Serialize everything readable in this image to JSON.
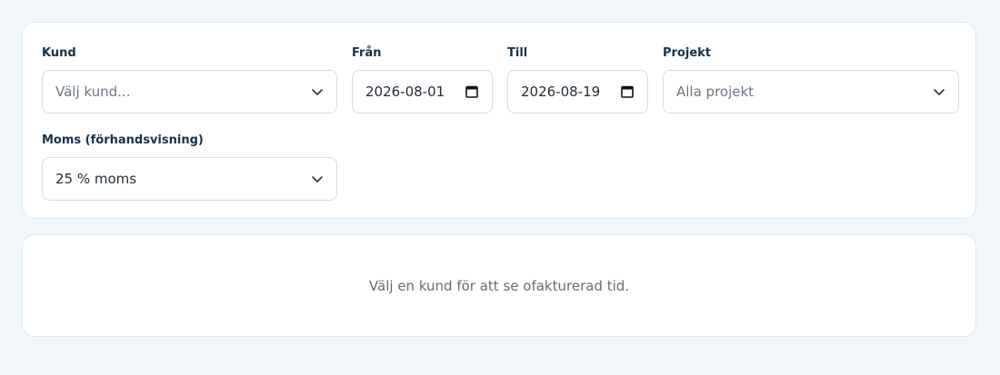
{
  "filters": {
    "customer": {
      "label": "Kund",
      "placeholder": "Välj kund..."
    },
    "from": {
      "label": "Från",
      "value": "2026-08-01"
    },
    "to": {
      "label": "Till",
      "value": "2026-08-19"
    },
    "project": {
      "label": "Projekt",
      "value": "Alla projekt"
    },
    "vat": {
      "label": "Moms (förhandsvisning)",
      "value": "25 % moms"
    }
  },
  "empty_state": {
    "message": "Välj en kund för att se ofakturerad tid."
  },
  "icons": {
    "select": "chevron-down-icon",
    "date": "calendar-icon"
  },
  "colors": {
    "background": "#f1f6fa",
    "label": "#17324a",
    "border": "#d4dde6",
    "muted": "#6b7785"
  }
}
